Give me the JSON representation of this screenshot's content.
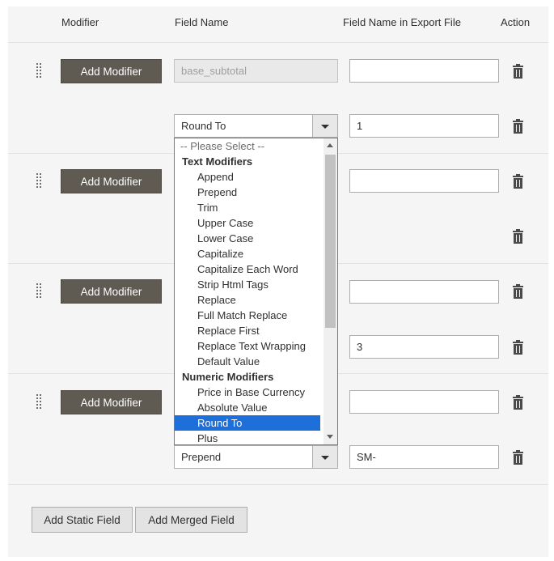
{
  "columns": {
    "modifier": "Modifier",
    "field_name": "Field Name",
    "export_name": "Field Name in Export File",
    "action": "Action"
  },
  "add_modifier_label": "Add Modifier",
  "rows": [
    {
      "field_name": "base_subtotal",
      "export_name": "",
      "modifier": {
        "type": "Round To",
        "value": "1"
      }
    },
    {
      "field_name": "",
      "export_name": ""
    },
    {
      "field_name": "",
      "export_name": "",
      "modifier": {
        "type": "",
        "value": "3"
      }
    },
    {
      "field_name": "",
      "export_name": "",
      "modifier": {
        "type": "Prepend",
        "value": "SM-"
      }
    }
  ],
  "dropdown": {
    "placeholder": "-- Please Select --",
    "groups": [
      {
        "label": "Text Modifiers",
        "items": [
          "Append",
          "Prepend",
          "Trim",
          "Upper Case",
          "Lower Case",
          "Capitalize",
          "Capitalize Each Word",
          "Strip Html Tags",
          "Replace",
          "Full Match Replace",
          "Replace First",
          "Replace Text Wrapping",
          "Default Value"
        ]
      },
      {
        "label": "Numeric Modifiers",
        "items": [
          "Price in Base Currency",
          "Absolute Value",
          "Round To",
          "Plus"
        ]
      }
    ],
    "selected": "Round To"
  },
  "footer": {
    "add_static_field": "Add Static Field",
    "add_merged_field": "Add Merged Field"
  },
  "colors": {
    "accent_selected": "#1e6fd9",
    "dark_button": "#5f5a52"
  },
  "icons": [
    "drag-handle-icon",
    "trash-icon",
    "chevron-down-icon"
  ]
}
